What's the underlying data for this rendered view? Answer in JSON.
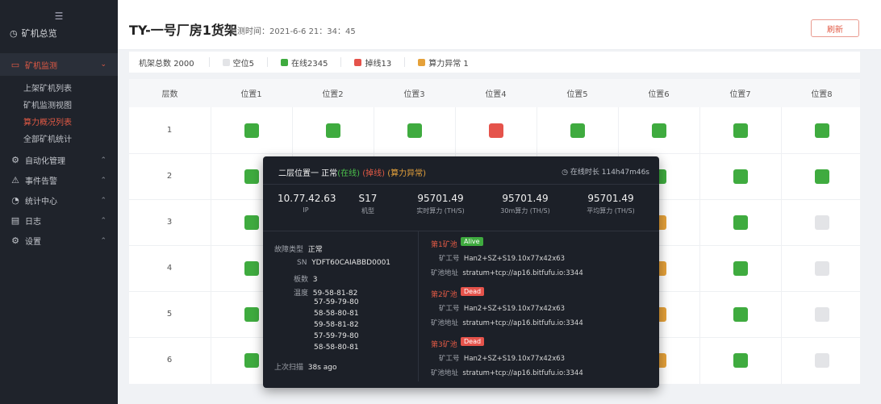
{
  "sidebar": {
    "collapse_icon": "☰",
    "overview": "矿机总览",
    "monitor": "矿机监测",
    "monitor_subs": [
      "上架矿机列表",
      "矿机监测视图",
      "算力概况列表",
      "全部矿机统计"
    ],
    "items": [
      {
        "label": "自动化管理",
        "icon": "automation-icon"
      },
      {
        "label": "事件告警",
        "icon": "alarm-icon"
      },
      {
        "label": "统计中心",
        "icon": "stats-icon"
      },
      {
        "label": "日志",
        "icon": "log-icon"
      },
      {
        "label": "设置",
        "icon": "settings-icon"
      }
    ]
  },
  "header": {
    "title": "TY-一号厂房1货架",
    "monitor_time": "监测时间：2021-6-6 21：34：45",
    "refresh": "刷新"
  },
  "stats": {
    "total_label": "机架总数",
    "total": "2000",
    "items": [
      {
        "label": "空位5",
        "color": "#e3e4e7"
      },
      {
        "label": "在线2345",
        "color": "#3fab3f"
      },
      {
        "label": "掉线13",
        "color": "#e5534b"
      },
      {
        "label": "算力异常 1",
        "color": "#e5a13a"
      }
    ]
  },
  "grid": {
    "header_layer": "层数",
    "positions": [
      "位置1",
      "位置2",
      "位置3",
      "位置4",
      "位置5",
      "位置6",
      "位置7",
      "位置8"
    ],
    "rows": [
      {
        "layer": "1",
        "slots": [
          "g",
          "g",
          "g",
          "r",
          "g",
          "g",
          "g",
          "g"
        ]
      },
      {
        "layer": "2",
        "slots": [
          "g",
          "g",
          "g",
          "g",
          "g",
          "g",
          "g",
          "g"
        ]
      },
      {
        "layer": "3",
        "slots": [
          "g",
          "g",
          "g",
          "g",
          "g",
          "o",
          "g",
          "e"
        ]
      },
      {
        "layer": "4",
        "slots": [
          "g",
          "g",
          "g",
          "g",
          "g",
          "o",
          "g",
          "e"
        ]
      },
      {
        "layer": "5",
        "slots": [
          "g",
          "g",
          "g",
          "g",
          "g",
          "o",
          "g",
          "e"
        ]
      },
      {
        "layer": "6",
        "slots": [
          "g",
          "g",
          "g",
          "g",
          "g",
          "o",
          "g",
          "e"
        ]
      }
    ]
  },
  "popup": {
    "title_prefix": "二层位置一 正常",
    "status_online": "(在线)",
    "status_offline": "(掉线)",
    "status_abnormal": "(算力异常)",
    "uptime": "◷ 在线时长 114h47m46s",
    "metrics": [
      {
        "value": "10.77.42.63",
        "label": "IP"
      },
      {
        "value": "S17",
        "label": "机型"
      },
      {
        "value": "95701.49",
        "label": "实时算力 (TH/S)"
      },
      {
        "value": "95701.49",
        "label": "30m算力 (TH/S)"
      },
      {
        "value": "95701.49",
        "label": "平均算力 (TH/S)"
      }
    ],
    "fault_type_label": "故障类型",
    "fault_type": "正常",
    "sn_label": "SN",
    "sn": "YDFT60CAIABBD0001",
    "board_label": "板数",
    "board": "3",
    "temp_label": "温度",
    "temps": [
      "59-58-81-82",
      "57-59-79-80",
      "58-58-80-81",
      "59-58-81-82",
      "57-59-79-80",
      "58-58-80-81"
    ],
    "last_scan_label": "上次扫描",
    "last_scan": "38s ago",
    "pools": [
      {
        "name": "第1矿池",
        "status": "Alive",
        "worker_label": "矿工号",
        "worker": "Han2+SZ+S19.10x77x42x63",
        "addr_label": "矿池地址",
        "addr": "stratum+tcp://ap16.bitfufu.io:3344"
      },
      {
        "name": "第2矿池",
        "status": "Dead",
        "worker_label": "矿工号",
        "worker": "Han2+SZ+S19.10x77x42x63",
        "addr_label": "矿池地址",
        "addr": "stratum+tcp://ap16.bitfufu.io:3344"
      },
      {
        "name": "第3矿池",
        "status": "Dead",
        "worker_label": "矿工号",
        "worker": "Han2+SZ+S19.10x77x42x63",
        "addr_label": "矿池地址",
        "addr": "stratum+tcp://ap16.bitfufu.io:3344"
      }
    ]
  }
}
